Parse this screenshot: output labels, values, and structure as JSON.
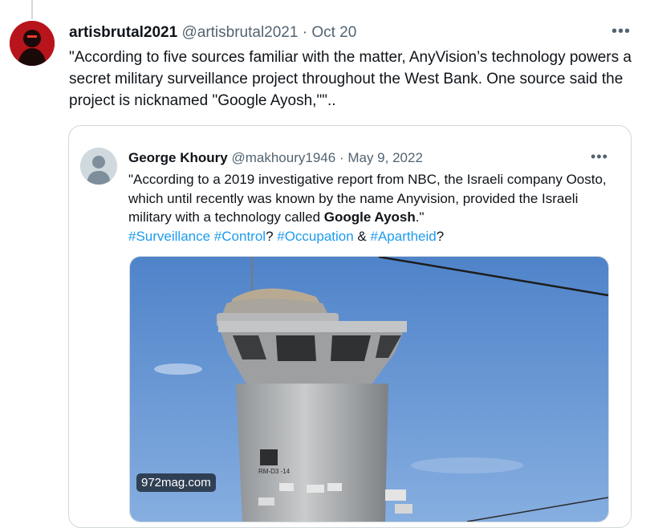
{
  "tweet": {
    "display_name": "artisbrutal2021",
    "handle": "@artisbrutal2021",
    "separator": "·",
    "date": "Oct 20",
    "more_glyph": "•••",
    "text": "\"According to five sources familiar with the matter, AnyVision’s  technology powers a secret military surveillance project throughout the  West Bank. One source said the project is nicknamed \"Google Ayosh,\"\".."
  },
  "quote": {
    "display_name": "George Khoury",
    "handle": "@makhoury1946",
    "separator": "·",
    "date": "May 9, 2022",
    "more_glyph": "•••",
    "text_part1": "\"According to a 2019 investigative report from NBC, the Israeli company Oosto, which until recently was known by the name Anyvision, provided the Israeli military with a technology called ",
    "text_bold": "Google Ayosh",
    "text_part2": ".\"",
    "hashtags": {
      "surveillance": "#Surveillance",
      "control": "#Control",
      "q1": "? ",
      "occupation": "#Occupation",
      "amp": " & ",
      "apartheid": "#Apartheid",
      "q2": "?"
    },
    "media": {
      "source_label": "972mag.com",
      "tower_marking": "RM-D3 -14"
    }
  },
  "colors": {
    "link": "#1d9bf0",
    "secondary_text": "#536471",
    "border": "#cfd9de",
    "avatar_red": "#c0161d",
    "sky": "#5f8fd0"
  },
  "icons": {
    "user_avatar": "red-portrait-avatar",
    "quote_avatar": "default-person-avatar",
    "more": "more-dots-icon"
  }
}
